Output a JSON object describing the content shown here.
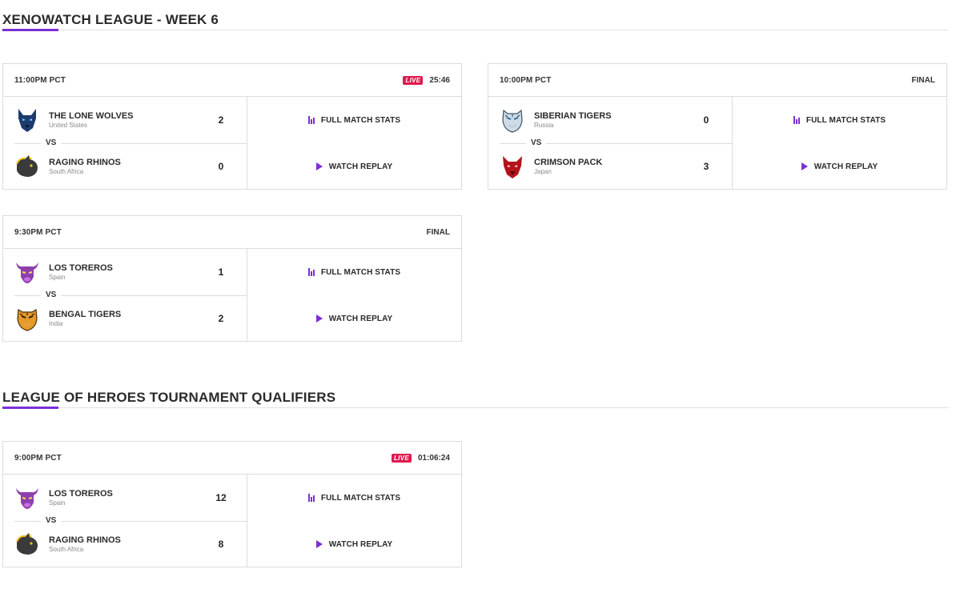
{
  "sections": [
    {
      "title": "XENOWATCH LEAGUE - WEEK 6",
      "matches": [
        {
          "time": "11:00PM PCT",
          "live": true,
          "status": "25:46",
          "team1": {
            "name": "THE LONE WOLVES",
            "country": "United States",
            "score": "2",
            "logo": "wolf-icon"
          },
          "team2": {
            "name": "RAGING RHINOS",
            "country": "South Africa",
            "score": "0",
            "logo": "rhino-icon"
          }
        },
        {
          "time": "10:00PM PCT",
          "live": false,
          "status": "FINAL",
          "team1": {
            "name": "SIBERIAN TIGERS",
            "country": "Russia",
            "score": "0",
            "logo": "white-tiger-icon"
          },
          "team2": {
            "name": "CRIMSON PACK",
            "country": "Japan",
            "score": "3",
            "logo": "red-wolf-icon"
          }
        },
        {
          "time": "9:30PM PCT",
          "live": false,
          "status": "FINAL",
          "team1": {
            "name": "LOS TOREROS",
            "country": "Spain",
            "score": "1",
            "logo": "bull-icon"
          },
          "team2": {
            "name": "BENGAL TIGERS",
            "country": "India",
            "score": "2",
            "logo": "tiger-icon"
          }
        }
      ]
    },
    {
      "title": "LEAGUE OF HEROES TOURNAMENT QUALIFIERS",
      "matches": [
        {
          "time": "9:00PM PCT",
          "live": true,
          "status": "01:06:24",
          "team1": {
            "name": "LOS TOREROS",
            "country": "Spain",
            "score": "12",
            "logo": "bull-icon"
          },
          "team2": {
            "name": "RAGING RHINOS",
            "country": "South Africa",
            "score": "8",
            "logo": "rhino-icon"
          }
        }
      ]
    }
  ],
  "labels": {
    "vs": "VS",
    "live": "LIVE",
    "stats": "FULL MATCH STATS",
    "replay": "WATCH REPLAY"
  },
  "colors": {
    "accent": "#7b2fd6",
    "live": "#e0194f"
  }
}
